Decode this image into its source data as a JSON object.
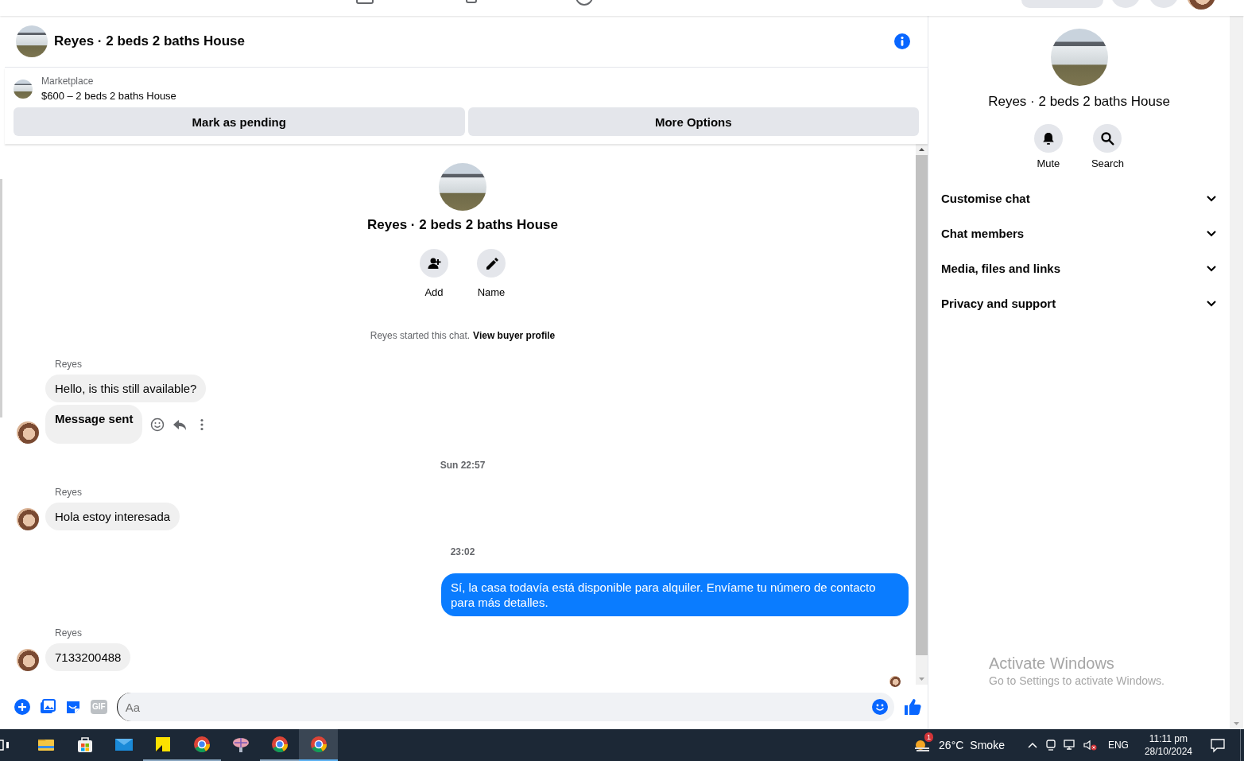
{
  "top_nav": {
    "pill": true
  },
  "chat": {
    "title": "Reyes · 2 beds 2 baths House",
    "listing": {
      "source": "Marketplace",
      "summary": "$600 – 2 beds 2 baths House"
    },
    "actions": [
      "Mark as pending",
      "More Options"
    ],
    "intro": {
      "name": "Reyes · 2 beds 2 baths House",
      "buttons": [
        {
          "kind": "add",
          "label": "Add"
        },
        {
          "kind": "name",
          "label": "Name"
        }
      ],
      "notice": "Reyes started this chat.",
      "link": "View buyer profile"
    },
    "messages": [
      {
        "kind": "incoming",
        "sender": "Reyes",
        "bubbles": [
          {
            "text": "Hello, is this still available?",
            "bold": false,
            "actions": false
          },
          {
            "text": "Message sent",
            "bold": true,
            "actions": true
          }
        ]
      },
      {
        "kind": "time",
        "text": "Sun 22:57"
      },
      {
        "kind": "incoming",
        "sender": "Reyes",
        "bubbles": [
          {
            "text": "Hola estoy interesada",
            "bold": false,
            "actions": false
          }
        ]
      },
      {
        "kind": "time",
        "text": "23:02"
      },
      {
        "kind": "outgoing",
        "bubbles": [
          {
            "text": "Sí, la casa todavía está disponible para alquiler. Envíame tu número de contacto para más detalles.",
            "bold": false,
            "actions": false
          }
        ]
      },
      {
        "kind": "incoming",
        "sender": "Reyes",
        "bubbles": [
          {
            "text": "7133200488",
            "bold": false,
            "actions": false
          }
        ]
      }
    ],
    "seen": true,
    "composer": {
      "gif_label": "GIF",
      "placeholder": "Aa"
    }
  },
  "details": {
    "name": "Reyes · 2 beds 2 baths House",
    "buttons": [
      {
        "kind": "mute",
        "label": "Mute"
      },
      {
        "kind": "search",
        "label": "Search"
      }
    ],
    "sections": [
      {
        "label": "Customise chat",
        "expanded": false
      },
      {
        "label": "Chat members",
        "expanded": false
      },
      {
        "label": "Media, files and links",
        "expanded": false
      },
      {
        "label": "Privacy and support",
        "expanded": false
      }
    ]
  },
  "activation": {
    "title": "Activate Windows",
    "hint": "Go to Settings to activate Windows."
  },
  "taskbar": {
    "apps": [
      {
        "kind": "explorer",
        "open": false,
        "selected": false
      },
      {
        "kind": "store",
        "open": false,
        "selected": false
      },
      {
        "kind": "mail",
        "open": false,
        "selected": false
      },
      {
        "kind": "notes",
        "open": true,
        "selected": false
      },
      {
        "kind": "chrome",
        "open": true,
        "selected": false
      },
      {
        "kind": "tool",
        "open": false,
        "selected": false
      },
      {
        "kind": "chrome",
        "open": true,
        "selected": false
      },
      {
        "kind": "chrome",
        "open": true,
        "selected": true
      }
    ],
    "weather": {
      "badge": "1",
      "temperature": "26°C",
      "condition": "Smoke"
    },
    "language": "ENG",
    "time": "11:11 pm",
    "date": "28/10/2024"
  }
}
